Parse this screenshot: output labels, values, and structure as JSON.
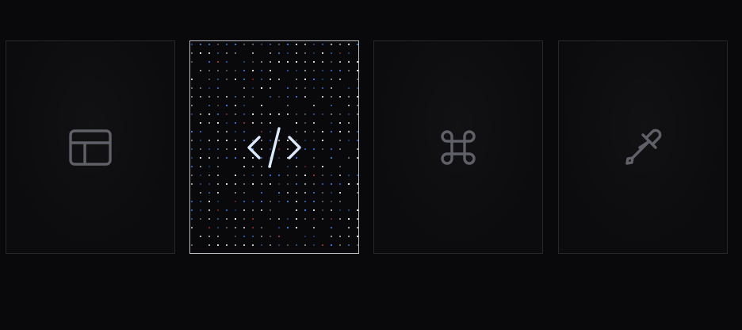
{
  "cards": [
    {
      "icon": "layout-panel-icon",
      "active": false
    },
    {
      "icon": "code-icon",
      "active": true
    },
    {
      "icon": "command-key-icon",
      "active": false
    },
    {
      "icon": "color-picker-pipette-icon",
      "active": false
    }
  ],
  "colors": {
    "background": "#09090b",
    "card_border": "#27272a",
    "active_border": "#b8bcc4",
    "icon_muted": "#5f6068",
    "icon_active": "#dbeafe",
    "dot_white": "#f4f4f5",
    "dot_blue": "#3b82f6",
    "dot_red": "#ef4444"
  }
}
